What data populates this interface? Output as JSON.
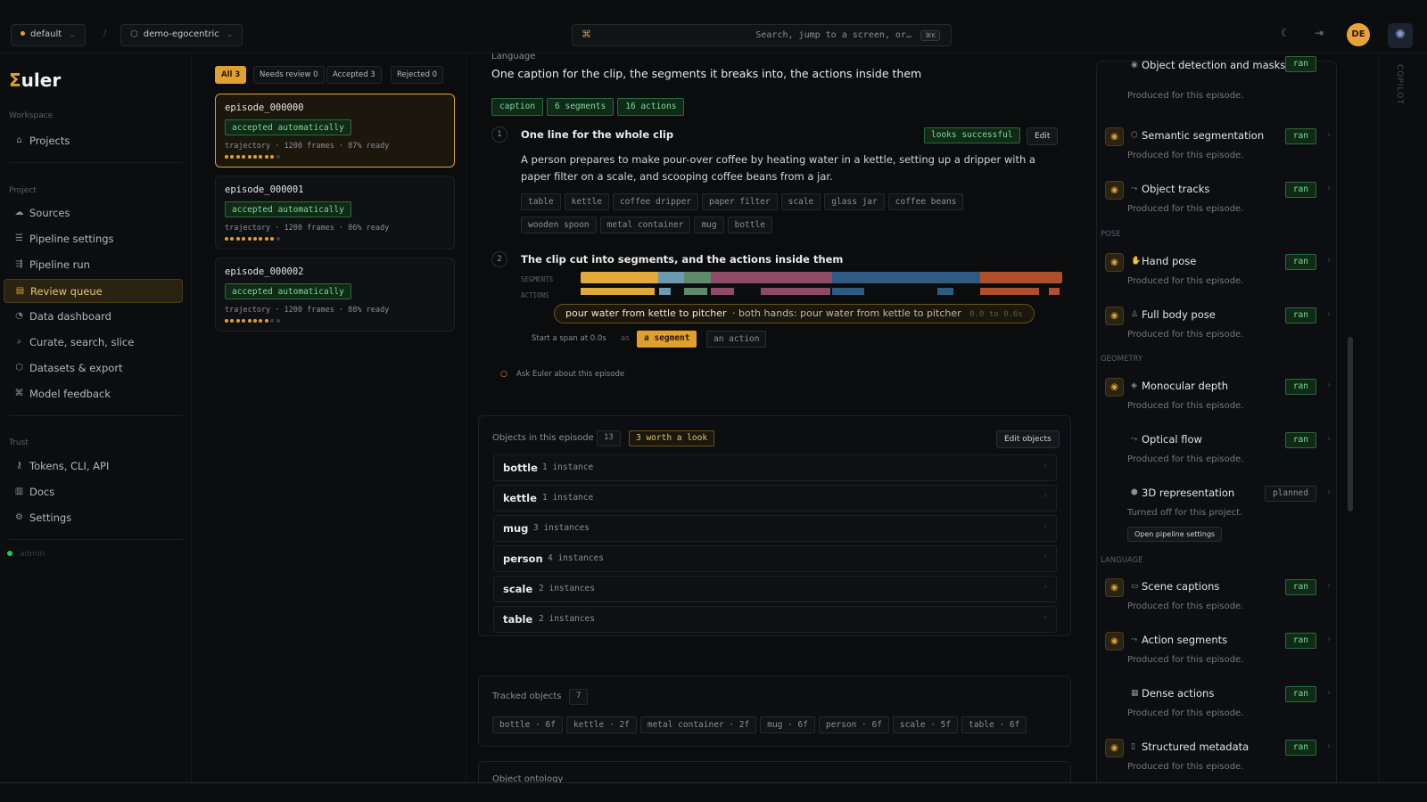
{
  "colors": {
    "accent": "#e0a030",
    "success": "#7fdc96",
    "background": "#0a0c0e"
  },
  "topbar": {
    "workspace": "default",
    "separator": "/",
    "project": "demo-egocentric",
    "search_placeholder": "Search, jump to a screen, or…",
    "search_kbd": "⌘K",
    "icons": [
      "moon-icon",
      "logout-icon",
      "copilot-icon"
    ],
    "avatar_initials": "DE"
  },
  "sidebar": {
    "logo": {
      "sigma": "Σ",
      "rest": "uler"
    },
    "workspace_label": "Workspace",
    "projects": "Projects",
    "project_label": "Project",
    "items": [
      {
        "label": "Sources",
        "icon": "cloud-icon"
      },
      {
        "label": "Pipeline settings",
        "icon": "sliders-icon"
      },
      {
        "label": "Pipeline run",
        "icon": "run-icon"
      },
      {
        "label": "Review queue",
        "icon": "queue-icon",
        "active": true
      },
      {
        "label": "Data dashboard",
        "icon": "gauge-icon"
      },
      {
        "label": "Curate, search, slice",
        "icon": "search-icon"
      },
      {
        "label": "Datasets & export",
        "icon": "box-icon"
      },
      {
        "label": "Model feedback",
        "icon": "feedback-icon"
      }
    ],
    "trust_label": "Trust",
    "trust_items": [
      {
        "label": "Tokens, CLI, API",
        "icon": "key-icon"
      },
      {
        "label": "Docs",
        "icon": "book-icon"
      },
      {
        "label": "Settings",
        "icon": "gear-icon"
      }
    ],
    "status_text": "admin"
  },
  "queue": {
    "tabs": [
      "All 3",
      "Needs review 0",
      "Accepted 3",
      "Rejected 0"
    ],
    "episodes": [
      {
        "name": "episode_000000",
        "status": "accepted automatically",
        "meta": "trajectory · 1200 frames · 87% ready",
        "filled": 9,
        "total": 10
      },
      {
        "name": "episode_000001",
        "status": "accepted automatically",
        "meta": "trajectory · 1200 frames · 86% ready",
        "filled": 9,
        "total": 10
      },
      {
        "name": "episode_000002",
        "status": "accepted automatically",
        "meta": "trajectory · 1200 frames · 88% ready",
        "filled": 8,
        "total": 10
      }
    ]
  },
  "language": {
    "section_label": "Language",
    "heading": "One caption for the clip, the segments it breaks into, the actions inside them",
    "chips": [
      "caption",
      "6 segments",
      "16 actions"
    ],
    "step1": {
      "num": "1",
      "title": "One line for the whole clip",
      "status": "looks successful",
      "edit": "Edit",
      "caption": "A person prepares to make pour-over coffee by heating water in a kettle, setting up a dripper with a paper filter on a scale, and scooping coffee beans from a jar.",
      "tags": [
        "table",
        "kettle",
        "coffee dripper",
        "paper filter",
        "scale",
        "glass jar",
        "coffee beans",
        "wooden spoon",
        "metal container",
        "mug",
        "bottle"
      ]
    },
    "step2": {
      "num": "2",
      "title": "The clip cut into segments, and the actions inside them",
      "segments_label": "SEGMENTS",
      "actions_label": "ACTIONS",
      "tooltip_main": "pour water from kettle to pitcher",
      "tooltip_sub": "· both hands: pour water from kettle to pitcher",
      "tooltip_time": "0.0 to 0.6s",
      "span_text": "Start a span at 0.0s",
      "span_as": "as",
      "opt_segment": "a segment",
      "opt_action": "an action"
    },
    "ask": "Ask Euler about this episode"
  },
  "objects": {
    "label": "Objects in this episode",
    "count": "13",
    "worth": "3 worth a look",
    "edit": "Edit objects",
    "rows": [
      {
        "name": "bottle",
        "count": "1 instance"
      },
      {
        "name": "kettle",
        "count": "1 instance"
      },
      {
        "name": "mug",
        "count": "3 instances"
      },
      {
        "name": "person",
        "count": "4 instances"
      },
      {
        "name": "scale",
        "count": "2 instances"
      },
      {
        "name": "table",
        "count": "2 instances"
      }
    ]
  },
  "tracked": {
    "label": "Tracked objects",
    "count": "7",
    "tags": [
      "bottle · 6f",
      "kettle · 2f",
      "metal container · 2f",
      "mug · 6f",
      "person · 6f",
      "scale · 5f",
      "table · 6f"
    ]
  },
  "ontology": {
    "label": "Object ontology"
  },
  "pipeline": {
    "top_item": {
      "title": "Object detection and masks",
      "status": "ran"
    },
    "produced": "Produced for this episode.",
    "groups": {
      "pose": "POSE",
      "geometry": "GEOMETRY",
      "language": "LANGUAGE"
    },
    "items": [
      {
        "title": "Semantic segmentation",
        "status": "ran",
        "icon": "segmentation-icon"
      },
      {
        "title": "Object tracks",
        "status": "ran",
        "icon": "tracks-icon"
      },
      {
        "title": "Hand pose",
        "status": "ran",
        "icon": "hand-icon"
      },
      {
        "title": "Full body pose",
        "status": "ran",
        "icon": "body-icon"
      },
      {
        "title": "Monocular depth",
        "status": "ran",
        "icon": "depth-icon"
      },
      {
        "title": "Optical flow",
        "status": "ran",
        "icon": "flow-icon"
      },
      {
        "title": "3D representation",
        "status": "planned",
        "icon": "cube-icon",
        "sub": "Turned off for this project.",
        "button": "Open pipeline settings"
      },
      {
        "title": "Scene captions",
        "status": "ran",
        "icon": "caption-icon"
      },
      {
        "title": "Action segments",
        "status": "ran",
        "icon": "action-icon"
      },
      {
        "title": "Dense actions",
        "status": "ran",
        "icon": "dense-icon"
      },
      {
        "title": "Structured metadata",
        "status": "ran",
        "icon": "file-icon"
      }
    ]
  },
  "copilot": {
    "label": "COPILOT"
  }
}
